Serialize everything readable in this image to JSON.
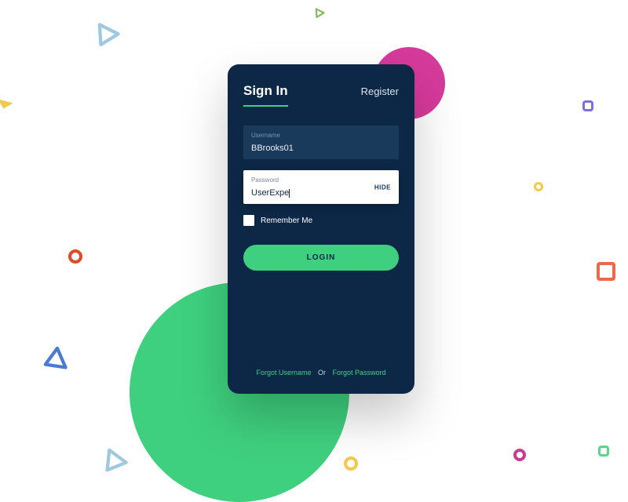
{
  "tabs": {
    "signin": "Sign In",
    "register": "Register"
  },
  "fields": {
    "username": {
      "label": "Username",
      "value": "BBrooks01"
    },
    "password": {
      "label": "Password",
      "value": "UserExpe",
      "toggle": "HIDE"
    }
  },
  "remember": {
    "label": "Remember Me"
  },
  "login_button": "LOGIN",
  "forgot": {
    "username": "Forgot Username",
    "or": "Or",
    "password": "Forgot Password"
  },
  "colors": {
    "card_bg": "#0d2847",
    "accent_green": "#3fd07f",
    "accent_pink": "#d63a9b"
  }
}
